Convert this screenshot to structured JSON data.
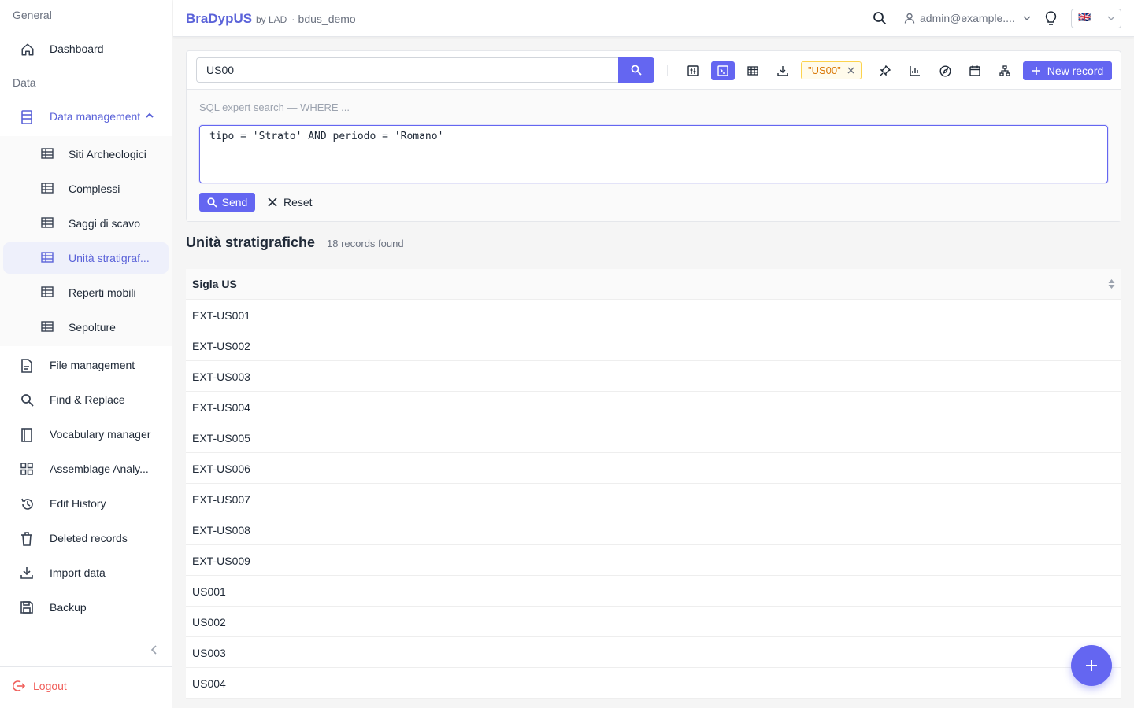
{
  "sidebar": {
    "group_general": "General",
    "group_data": "Data",
    "items": {
      "dashboard": "Dashboard",
      "data_management": "Data management",
      "file_management": "File management",
      "find_replace": "Find & Replace",
      "vocabulary": "Vocabulary manager",
      "assemblage": "Assemblage Analy...",
      "edit_history": "Edit History",
      "deleted": "Deleted records",
      "import": "Import data",
      "backup": "Backup"
    },
    "sub_items": [
      {
        "label": "Siti Archeologici",
        "active": false
      },
      {
        "label": "Complessi",
        "active": false
      },
      {
        "label": "Saggi di scavo",
        "active": false
      },
      {
        "label": "Unità stratigraf...",
        "active": true
      },
      {
        "label": "Reperti mobili",
        "active": false
      },
      {
        "label": "Sepolture",
        "active": false
      }
    ],
    "logout": "Logout"
  },
  "header": {
    "brand": "BraDypUS",
    "by": "by LAD",
    "db": "· bdus_demo",
    "user": "admin@example....",
    "lang_flag": "🇬🇧"
  },
  "search": {
    "value": "US00",
    "filter_tag": "\"US00\"",
    "new_record": "New record",
    "sql_label": "SQL expert search — WHERE ...",
    "sql_query": "tipo = 'Strato' AND periodo = 'Romano'",
    "send": "Send",
    "reset": "Reset"
  },
  "results": {
    "title": "Unità stratigrafiche",
    "count": "18 records found",
    "column": "Sigla US",
    "rows": [
      "EXT-US001",
      "EXT-US002",
      "EXT-US003",
      "EXT-US004",
      "EXT-US005",
      "EXT-US006",
      "EXT-US007",
      "EXT-US008",
      "EXT-US009",
      "US001",
      "US002",
      "US003",
      "US004"
    ]
  },
  "colors": {
    "accent": "#6466f1",
    "logout": "#f0605c",
    "tag": "#d97706"
  }
}
